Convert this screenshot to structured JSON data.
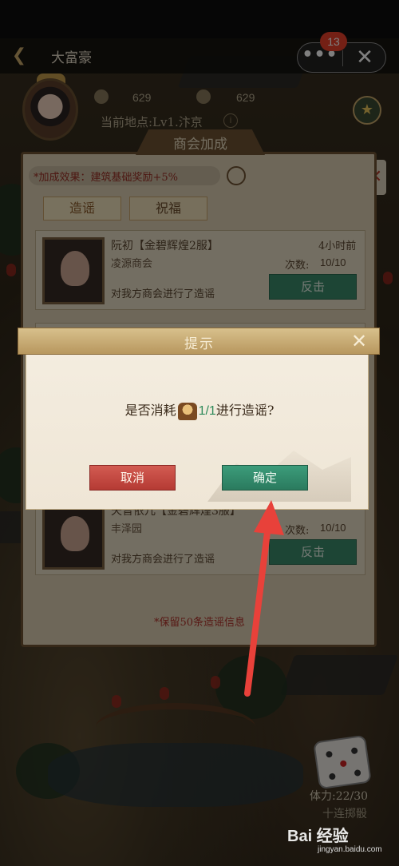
{
  "header": {
    "title": "大富豪",
    "back_icon": "back-arrow-icon"
  },
  "capsule": {
    "more_label": "•••",
    "close_label": "✕",
    "badge_count": "13"
  },
  "player": {
    "silver": "629",
    "gold": "629",
    "location": "当前地点:Lv1.汴京"
  },
  "panel": {
    "title": "商会加成",
    "bonus_text": "*加成效果：建筑基础奖励+5%",
    "tabs": [
      "造谣",
      "祝福"
    ],
    "records": [
      {
        "name": "阮初【金碧辉煌2服】",
        "guild": "凌源商会",
        "time": "4小时前",
        "count_label": "次数:",
        "count": "10/10",
        "desc": "对我方商会进行了造谣",
        "action": "反击"
      },
      {
        "name": "天音依儿【金碧辉煌3服】",
        "guild": "丰泽园",
        "time": "",
        "count_label": "次数:",
        "count": "10/10",
        "desc": "对我方商会进行了造谣",
        "action": "反击"
      }
    ],
    "retain_note": "*保留50条造谣信息"
  },
  "dialog": {
    "title": "提示",
    "question_pre": "是否消耗",
    "question_num": "1/1",
    "question_post": "进行造谣?",
    "cancel_label": "取消",
    "ok_label": "确定"
  },
  "bottom": {
    "stamina": "体力:22/30",
    "ten_roll": "十连掷骰"
  },
  "watermark": {
    "brand": "Bai 经验",
    "url": "jingyan.baidu.com"
  },
  "colors": {
    "ok_button": "#2f8a6a",
    "cancel_button": "#c24840",
    "annotation_arrow": "#e8413a"
  }
}
